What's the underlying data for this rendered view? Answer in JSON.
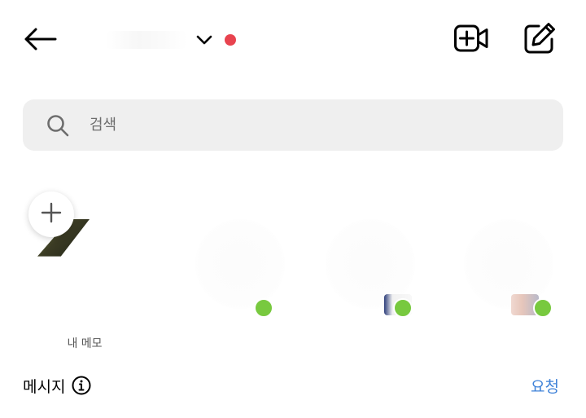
{
  "header": {
    "back_icon": "arrow-left-icon",
    "account_name": "",
    "switcher_icon": "chevron-down-icon",
    "status_dot_color": "#e8434f",
    "video_icon": "video-plus-icon",
    "compose_icon": "edit-icon"
  },
  "search": {
    "icon": "search-icon",
    "placeholder": "검색",
    "value": ""
  },
  "notes": {
    "add_icon": "plus-icon",
    "my_note_label": "내 메모",
    "online_color": "#78c93f",
    "friends": [
      {
        "name": "",
        "online": true
      },
      {
        "name": "",
        "online": true
      },
      {
        "name": "",
        "online": true
      }
    ]
  },
  "messages": {
    "title": "메시지",
    "info_icon": "info-icon",
    "requests_label": "요청",
    "requests_color": "#3f82d8"
  }
}
